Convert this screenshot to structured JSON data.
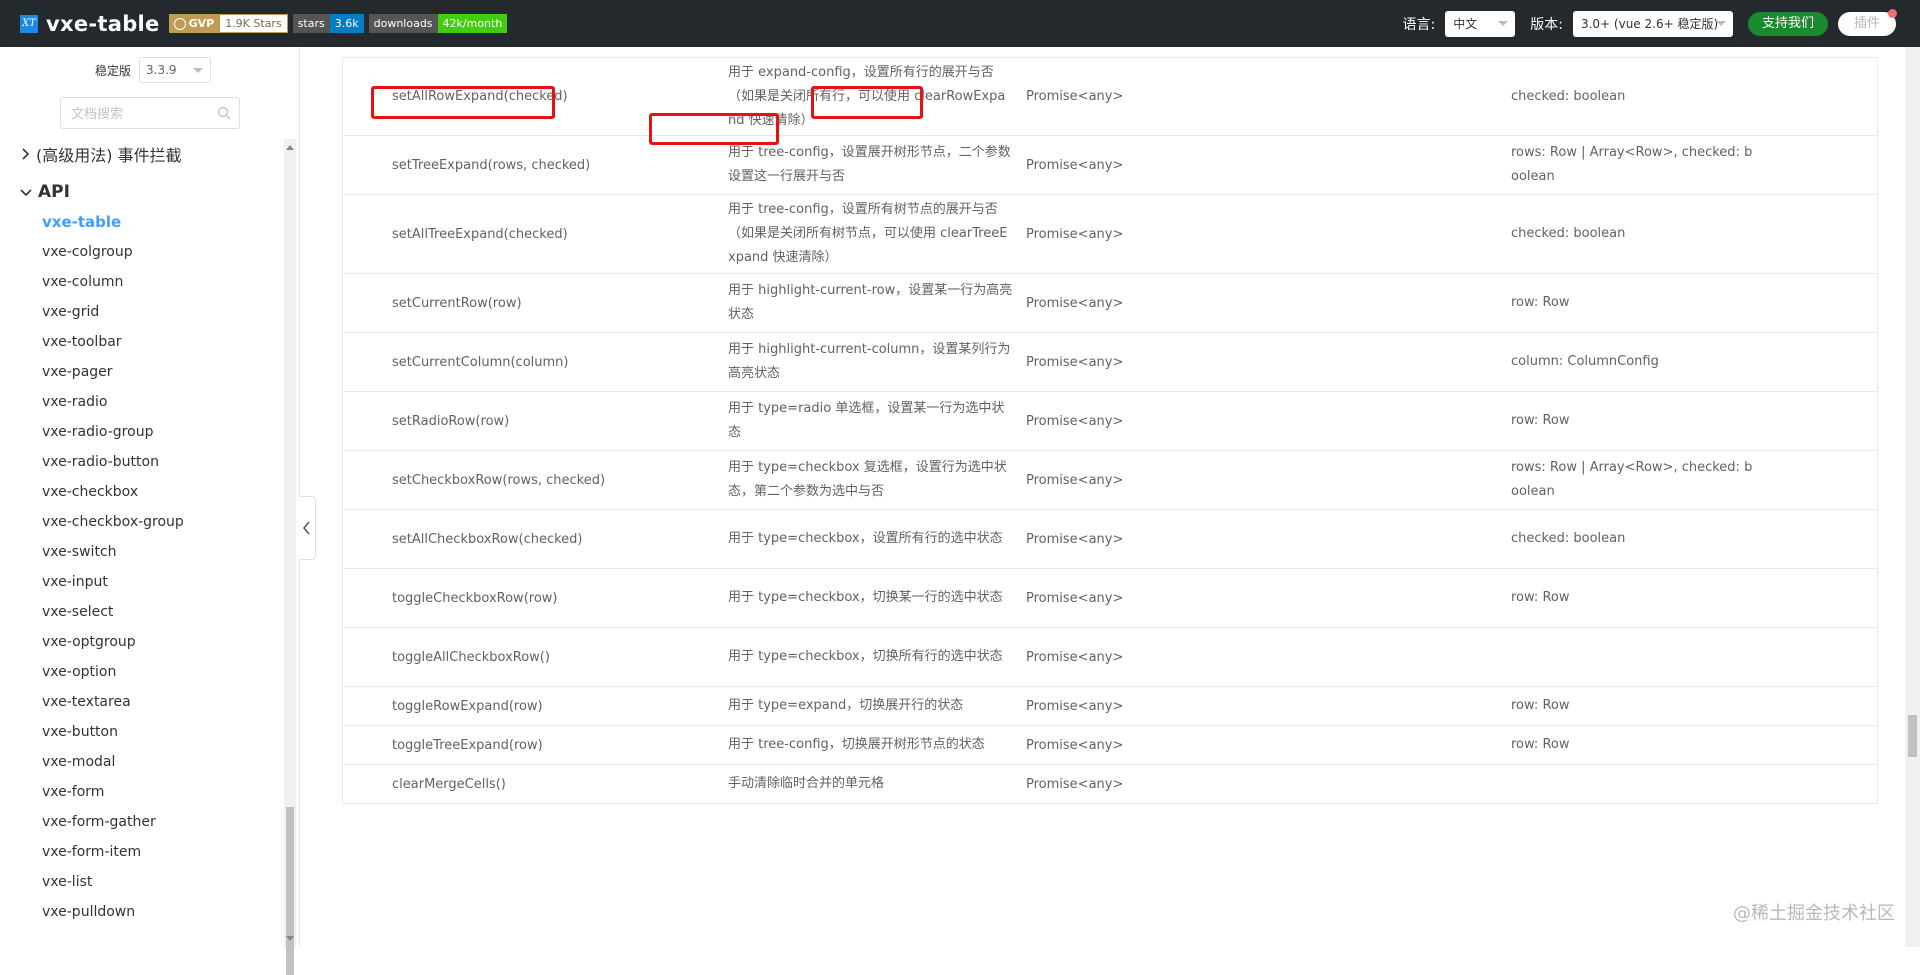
{
  "header": {
    "brand": "vxe-table",
    "logo_text": "XT",
    "badges": [
      {
        "key": "GVP",
        "value": "1.9K Stars",
        "key_color": "#c09b53"
      },
      {
        "key": "stars",
        "value": "3.6k",
        "value_color": "#007ec6"
      },
      {
        "key": "downloads",
        "value": "42k/month",
        "value_color": "#44cc11"
      }
    ],
    "language_label": "语言:",
    "language_value": "中文",
    "version_label": "版本:",
    "version_value": "3.0+ (vue 2.6+ 稳定版)",
    "support_button": "支持我们",
    "plugin_button": "插件"
  },
  "sidebar": {
    "stable_label": "稳定版",
    "stable_version": "3.3.9",
    "search_placeholder": "文档搜索",
    "groups": [
      {
        "label": "(高级用法) 事件拦截",
        "expanded": false
      },
      {
        "label": "API",
        "expanded": true
      }
    ],
    "items": [
      {
        "label": "vxe-table",
        "active": true
      },
      {
        "label": "vxe-colgroup"
      },
      {
        "label": "vxe-column"
      },
      {
        "label": "vxe-grid"
      },
      {
        "label": "vxe-toolbar"
      },
      {
        "label": "vxe-pager"
      },
      {
        "label": "vxe-radio"
      },
      {
        "label": "vxe-radio-group"
      },
      {
        "label": "vxe-radio-button"
      },
      {
        "label": "vxe-checkbox"
      },
      {
        "label": "vxe-checkbox-group"
      },
      {
        "label": "vxe-switch"
      },
      {
        "label": "vxe-input"
      },
      {
        "label": "vxe-select"
      },
      {
        "label": "vxe-optgroup"
      },
      {
        "label": "vxe-option"
      },
      {
        "label": "vxe-textarea"
      },
      {
        "label": "vxe-button"
      },
      {
        "label": "vxe-modal"
      },
      {
        "label": "vxe-form"
      },
      {
        "label": "vxe-form-gather"
      },
      {
        "label": "vxe-form-item"
      },
      {
        "label": "vxe-list"
      },
      {
        "label": "vxe-pulldown"
      }
    ]
  },
  "methods": [
    {
      "name": "setAllRowExpand(checked)",
      "desc": "用于 expand-config，设置所有行的展开与否（如果是关闭所有行，可以使用 clearRowExpand 快速清除）",
      "returns": "Promise<any>",
      "params": "checked: boolean"
    },
    {
      "name": "setTreeExpand(rows, checked)",
      "desc": "用于 tree-config，设置展开树形节点，二个参数设置这一行展开与否",
      "returns": "Promise<any>",
      "params": "rows: Row | Array<Row>, checked: boolean"
    },
    {
      "name": "setAllTreeExpand(checked)",
      "desc": "用于 tree-config，设置所有树节点的展开与否（如果是关闭所有树节点，可以使用 clearTreeExpand 快速清除）",
      "returns": "Promise<any>",
      "params": "checked: boolean"
    },
    {
      "name": "setCurrentRow(row)",
      "desc": "用于 highlight-current-row，设置某一行为高亮状态",
      "returns": "Promise<any>",
      "params": "row: Row"
    },
    {
      "name": "setCurrentColumn(column)",
      "desc": "用于 highlight-current-column，设置某列行为高亮状态",
      "returns": "Promise<any>",
      "params": "column: ColumnConfig"
    },
    {
      "name": "setRadioRow(row)",
      "desc": "用于 type=radio 单选框，设置某一行为选中状态",
      "returns": "Promise<any>",
      "params": "row: Row"
    },
    {
      "name": "setCheckboxRow(rows, checked)",
      "desc": "用于 type=checkbox 复选框，设置行为选中状态，第二个参数为选中与否",
      "returns": "Promise<any>",
      "params": "rows: Row | Array<Row>, checked: boolean"
    },
    {
      "name": "setAllCheckboxRow(checked)",
      "desc": "用于 type=checkbox，设置所有行的选中状态",
      "returns": "Promise<any>",
      "params": "checked: boolean"
    },
    {
      "name": "toggleCheckboxRow(row)",
      "desc": "用于 type=checkbox，切换某一行的选中状态",
      "returns": "Promise<any>",
      "params": "row: Row"
    },
    {
      "name": "toggleAllCheckboxRow()",
      "desc": "用于 type=checkbox，切换所有行的选中状态",
      "returns": "Promise<any>",
      "params": ""
    },
    {
      "name": "toggleRowExpand(row)",
      "desc": "用于 type=expand，切换展开行的状态",
      "returns": "Promise<any>",
      "params": "row: Row"
    },
    {
      "name": "toggleTreeExpand(row)",
      "desc": "用于 tree-config，切换展开树形节点的状态",
      "returns": "Promise<any>",
      "params": "row: Row"
    },
    {
      "name": "clearMergeCells()",
      "desc": "手动清除临时合并的单元格",
      "returns": "Promise<any>",
      "params": ""
    }
  ],
  "watermark": "@稀土掘金技术社区",
  "colors": {
    "highlight": "#e81010",
    "active": "#409eff",
    "header_bg": "#24292e"
  }
}
